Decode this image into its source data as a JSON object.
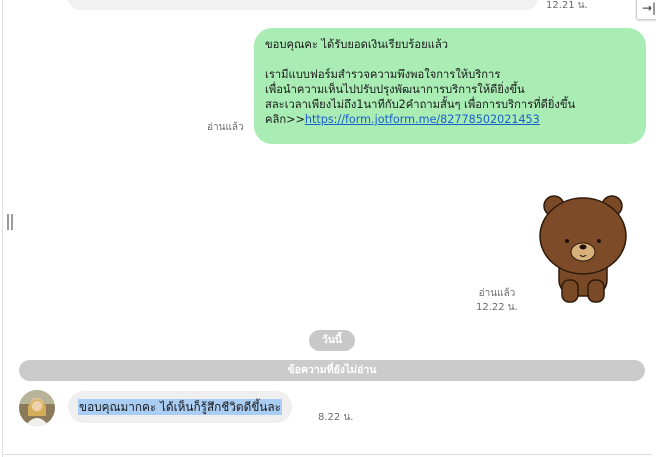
{
  "top": {
    "time": "12.21 น.",
    "corner_icon": "exit-arrow-icon",
    "corner_glyph": "→|"
  },
  "outgoing": {
    "line1": "ขอบคุณคะ ได้รับยอดเงินเรียบร้อยแล้ว",
    "line2": "เรามีแบบฟอร์มสำรวจความพึงพอใจการให้บริการ",
    "line3": "เพื่อนำความเห็นไปปรับปรุงพัฒนาการบริการให้ดียิ่งขึ้น",
    "line4": "สละเวลาเพียงไม่ถึง1นาทีกับ2คำถามสั้นๆ เพื่อการบริการที่ดียิ่งขึ้น",
    "link_prefix": "คลิก>>",
    "link_text": "https://form.jotform.me/82778502021453",
    "read_label": "อ่านแล้ว"
  },
  "sticker_message": {
    "icon": "brown-bear-sticker",
    "read_label": "อ่านแล้ว",
    "time": "12.22 น."
  },
  "today_label": "วันนี้",
  "unread_label": "ข้อความที่ยังไม่อ่าน",
  "incoming": {
    "text": "ขอบคุณมากคะ ได้เห็นก็รู้สึกชีวิตดีขึ้นละ",
    "time": "8.22 น."
  },
  "colors": {
    "outgoing_bubble": "#a9ecb4",
    "incoming_bubble": "#efefef",
    "selection": "#a9cdf3",
    "pill": "#c8c8c8"
  }
}
